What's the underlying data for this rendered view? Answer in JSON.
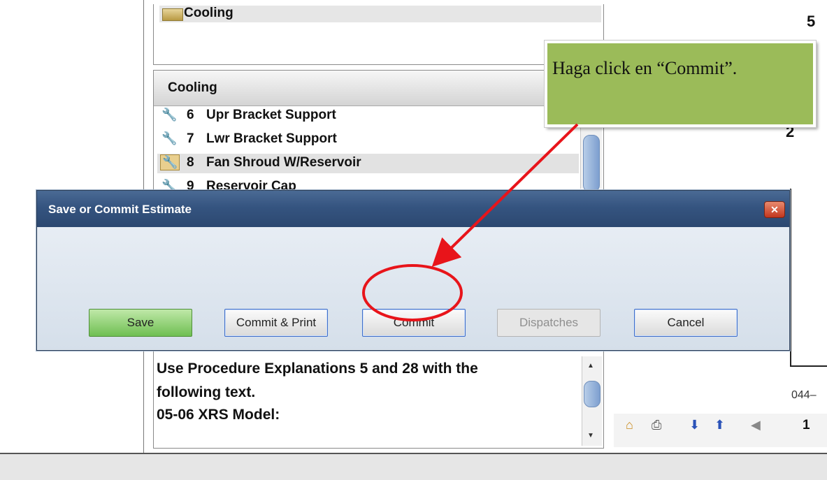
{
  "top_tree": {
    "folder_label": "Cooling"
  },
  "parts_list": {
    "header": "Cooling",
    "rows": [
      {
        "num": "6",
        "name": "Upr Bracket Support"
      },
      {
        "num": "7",
        "name": "Lwr Bracket Support"
      },
      {
        "num": "8",
        "name": "Fan Shroud W/Reservoir"
      },
      {
        "num": "9",
        "name": "Reservoir Cap"
      }
    ]
  },
  "notes": {
    "lines": [
      "Use Procedure Explanations 5 and 28 with the",
      "following text.",
      "05-06 XRS Model:"
    ]
  },
  "diagram": {
    "label_top": "5",
    "label_mid": "2",
    "code": "044–"
  },
  "nav_toolbar": {
    "page": "1"
  },
  "dialog": {
    "title": "Save or Commit Estimate",
    "close_glyph": "✕",
    "buttons": {
      "save": "Save",
      "commit_print": "Commit & Print",
      "commit": "Commit",
      "dispatches": "Dispatches",
      "cancel": "Cancel"
    }
  },
  "annotation": {
    "callout_text": "Haga click en “Commit”.",
    "callout_color": "#9bbb59",
    "highlight_color": "#e8141a"
  }
}
